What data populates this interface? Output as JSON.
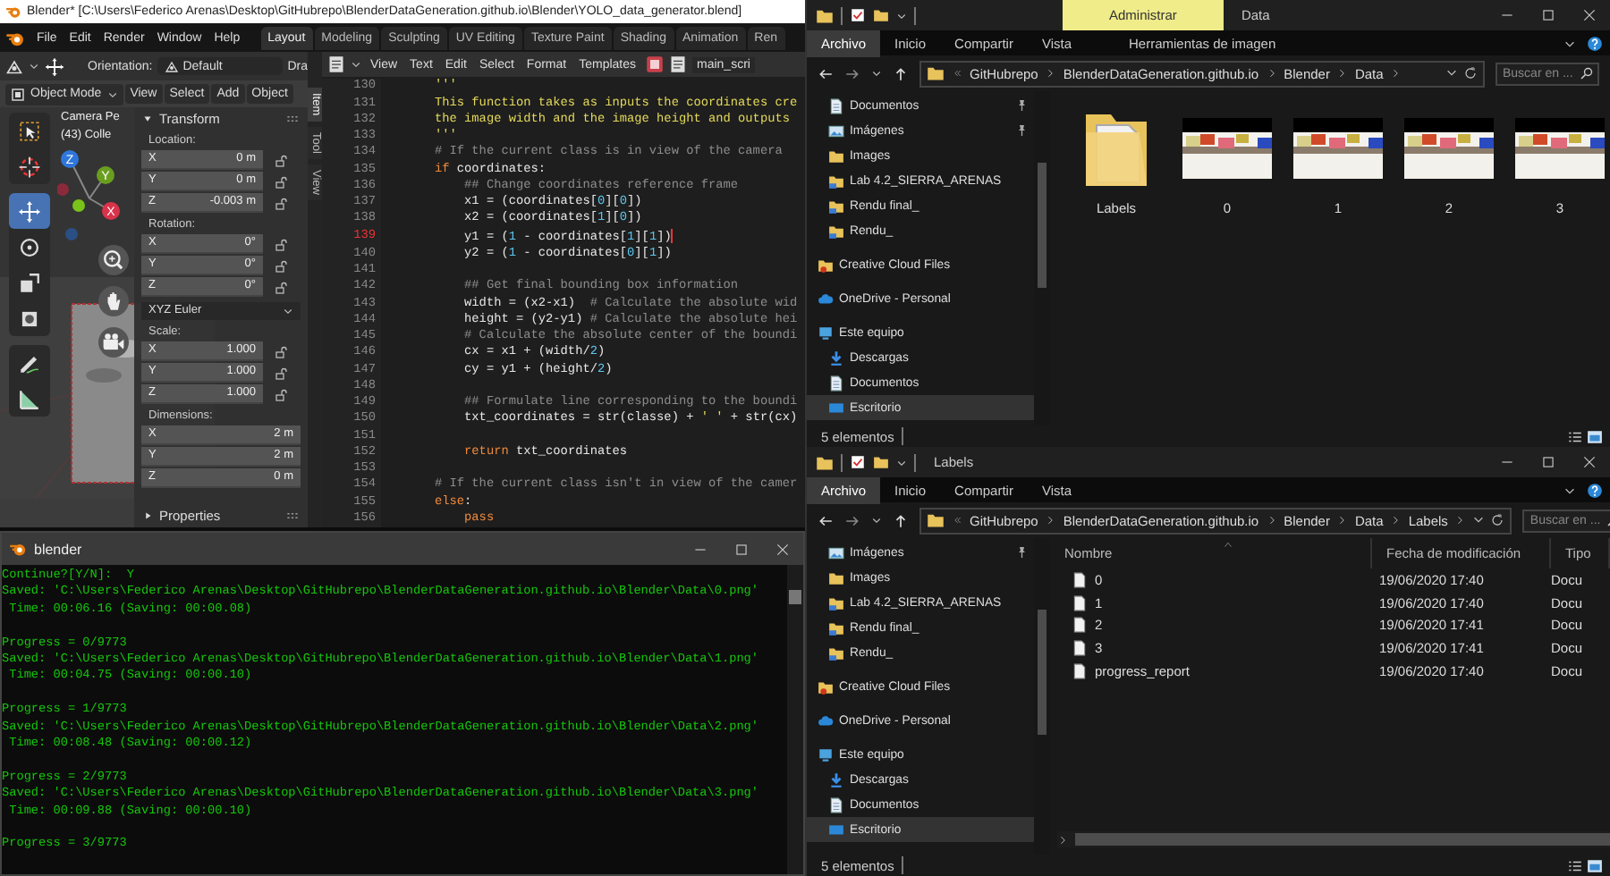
{
  "blender": {
    "title": "Blender* [C:\\Users\\Federico Arenas\\Desktop\\GitHubrepo\\BlenderDataGeneration.github.io\\Blender\\YOLO_data_generator.blend]",
    "menu": [
      "File",
      "Edit",
      "Render",
      "Window",
      "Help"
    ],
    "workspaces": [
      {
        "label": "Layout",
        "selected": true
      },
      {
        "label": "Modeling",
        "selected": false
      },
      {
        "label": "Sculpting",
        "selected": false
      },
      {
        "label": "UV Editing",
        "selected": false
      },
      {
        "label": "Texture Paint",
        "selected": false
      },
      {
        "label": "Shading",
        "selected": false
      },
      {
        "label": "Animation",
        "selected": false
      },
      {
        "label": "Ren",
        "selected": false
      }
    ],
    "viewport": {
      "orientation_label": "Orientation:",
      "orientation": "Default",
      "cut_label": "Dra",
      "mode": "Object Mode",
      "menu": [
        "View",
        "Select",
        "Add",
        "Object"
      ],
      "overlay": [
        "Camera Pe",
        "(43) Colle"
      ],
      "axes": [
        "Z",
        "Y",
        "X"
      ],
      "tool_groups": [
        [
          {
            "kind": "select",
            "selected": false
          },
          {
            "kind": "cursor",
            "selected": false
          }
        ],
        [
          {
            "kind": "move",
            "selected": true
          },
          {
            "kind": "rotate",
            "selected": false
          },
          {
            "kind": "scale",
            "selected": false
          },
          {
            "kind": "transform",
            "selected": false
          }
        ],
        [
          {
            "kind": "annotate",
            "selected": false
          },
          {
            "kind": "measure",
            "selected": false
          }
        ]
      ],
      "sidebar_tabs": [
        {
          "label": "Item",
          "selected": true
        },
        {
          "label": "Tool",
          "selected": false
        },
        {
          "label": "View",
          "selected": false
        }
      ],
      "transform": {
        "title": "Transform",
        "sections": [
          {
            "kind": "fields",
            "label": "Location:",
            "lockable": true,
            "fields": [
              {
                "axis": "X",
                "value": "0 m"
              },
              {
                "axis": "Y",
                "value": "0 m"
              },
              {
                "axis": "Z",
                "value": "-0.003 m"
              }
            ]
          },
          {
            "kind": "fields",
            "label": "Rotation:",
            "lockable": true,
            "fields": [
              {
                "axis": "X",
                "value": "0°"
              },
              {
                "axis": "Y",
                "value": "0°"
              },
              {
                "axis": "Z",
                "value": "0°"
              }
            ]
          },
          {
            "kind": "dropdown",
            "value": "XYZ Euler"
          },
          {
            "kind": "fields",
            "label": "Scale:",
            "lockable": true,
            "fields": [
              {
                "axis": "X",
                "value": "1.000"
              },
              {
                "axis": "Y",
                "value": "1.000"
              },
              {
                "axis": "Z",
                "value": "1.000"
              }
            ]
          },
          {
            "kind": "fields",
            "label": "Dimensions:",
            "lockable": false,
            "fields": [
              {
                "axis": "X",
                "value": "2 m"
              },
              {
                "axis": "Y",
                "value": "2 m"
              },
              {
                "axis": "Z",
                "value": "0 m"
              }
            ]
          }
        ]
      },
      "properties": {
        "label": "Properties",
        "expanded": false
      }
    },
    "text_editor": {
      "menu": [
        "View",
        "Text",
        "Edit",
        "Select",
        "Format",
        "Templates"
      ],
      "file": "main_scri",
      "lines": [
        {
          "number": "130",
          "selected": false,
          "segments": [
            {
              "kind": "string",
              "text": "'''"
            }
          ]
        },
        {
          "number": "131",
          "selected": false,
          "segments": [
            {
              "kind": "string",
              "text": "This function takes as inputs the coordinates cre"
            }
          ]
        },
        {
          "number": "132",
          "selected": false,
          "segments": [
            {
              "kind": "string",
              "text": "the image width and the image height and outputs"
            }
          ]
        },
        {
          "number": "133",
          "selected": false,
          "segments": [
            {
              "kind": "string",
              "text": "'''"
            }
          ]
        },
        {
          "number": "134",
          "selected": false,
          "segments": [
            {
              "kind": "comment",
              "text": "# If the current class is in view of the camera"
            }
          ]
        },
        {
          "number": "135",
          "selected": false,
          "segments": [
            {
              "kind": "keyword",
              "text": "if"
            },
            {
              "kind": "plain",
              "text": " coordinates:"
            }
          ]
        },
        {
          "number": "136",
          "selected": false,
          "segments": [
            {
              "kind": "comment",
              "text": "    ## Change coordinates reference frame"
            }
          ]
        },
        {
          "number": "137",
          "selected": false,
          "segments": [
            {
              "kind": "plain",
              "text": "    x1 = (coordinates["
            },
            {
              "kind": "number",
              "text": "0"
            },
            {
              "kind": "plain",
              "text": "]["
            },
            {
              "kind": "number",
              "text": "0"
            },
            {
              "kind": "plain",
              "text": "])"
            }
          ]
        },
        {
          "number": "138",
          "selected": false,
          "segments": [
            {
              "kind": "plain",
              "text": "    x2 = (coordinates["
            },
            {
              "kind": "number",
              "text": "1"
            },
            {
              "kind": "plain",
              "text": "]["
            },
            {
              "kind": "number",
              "text": "0"
            },
            {
              "kind": "plain",
              "text": "])"
            }
          ]
        },
        {
          "number": "139",
          "selected": true,
          "segments": [
            {
              "kind": "plain",
              "text": "    y1 = ("
            },
            {
              "kind": "number",
              "text": "1"
            },
            {
              "kind": "plain",
              "text": " - coordinates["
            },
            {
              "kind": "number",
              "text": "1"
            },
            {
              "kind": "plain",
              "text": "]["
            },
            {
              "kind": "number",
              "text": "1"
            },
            {
              "kind": "plain",
              "text": "])"
            }
          ]
        },
        {
          "number": "140",
          "selected": false,
          "segments": [
            {
              "kind": "plain",
              "text": "    y2 = ("
            },
            {
              "kind": "number",
              "text": "1"
            },
            {
              "kind": "plain",
              "text": " - coordinates["
            },
            {
              "kind": "number",
              "text": "0"
            },
            {
              "kind": "plain",
              "text": "]["
            },
            {
              "kind": "number",
              "text": "1"
            },
            {
              "kind": "plain",
              "text": "])"
            }
          ]
        },
        {
          "number": "141",
          "selected": false
        },
        {
          "number": "142",
          "selected": false,
          "segments": [
            {
              "kind": "comment",
              "text": "    ## Get final bounding box information"
            }
          ]
        },
        {
          "number": "143",
          "selected": false,
          "segments": [
            {
              "kind": "plain",
              "text": "    width = (x2-x1)  "
            },
            {
              "kind": "comment",
              "text": "# Calculate the absolute wid"
            }
          ]
        },
        {
          "number": "144",
          "selected": false,
          "segments": [
            {
              "kind": "plain",
              "text": "    height = (y2-y1) "
            },
            {
              "kind": "comment",
              "text": "# Calculate the absolute hei"
            }
          ]
        },
        {
          "number": "145",
          "selected": false,
          "segments": [
            {
              "kind": "comment",
              "text": "    # Calculate the absolute center of the boundi"
            }
          ]
        },
        {
          "number": "146",
          "selected": false,
          "segments": [
            {
              "kind": "plain",
              "text": "    cx = x1 + (width/"
            },
            {
              "kind": "number",
              "text": "2"
            },
            {
              "kind": "plain",
              "text": ")"
            }
          ]
        },
        {
          "number": "147",
          "selected": false,
          "segments": [
            {
              "kind": "plain",
              "text": "    cy = y1 + (height/"
            },
            {
              "kind": "number",
              "text": "2"
            },
            {
              "kind": "plain",
              "text": ")"
            }
          ]
        },
        {
          "number": "148",
          "selected": false
        },
        {
          "number": "149",
          "selected": false,
          "segments": [
            {
              "kind": "comment",
              "text": "    ## Formulate line corresponding to the boundi"
            }
          ]
        },
        {
          "number": "150",
          "selected": false,
          "segments": [
            {
              "kind": "plain",
              "text": "    txt_coordinates = str(classe) + "
            },
            {
              "kind": "string",
              "text": "' '"
            },
            {
              "kind": "plain",
              "text": " + str(cx)"
            }
          ]
        },
        {
          "number": "151",
          "selected": false
        },
        {
          "number": "152",
          "selected": false,
          "segments": [
            {
              "kind": "keyword",
              "text": "    return"
            },
            {
              "kind": "plain",
              "text": " txt_coordinates"
            }
          ]
        },
        {
          "number": "153",
          "selected": false
        },
        {
          "number": "154",
          "selected": false,
          "segments": [
            {
              "kind": "comment",
              "text": "# If the current class isn't in view of the camer"
            }
          ]
        },
        {
          "number": "155",
          "selected": false,
          "segments": [
            {
              "kind": "keyword",
              "text": "else"
            },
            {
              "kind": "plain",
              "text": ":"
            }
          ]
        },
        {
          "number": "156",
          "selected": false,
          "segments": [
            {
              "kind": "keyword",
              "text": "    pass"
            }
          ]
        }
      ]
    }
  },
  "console": {
    "title": "blender",
    "blocks": [
      [
        "Continue?[Y/N]:  Y",
        "Saved: 'C:\\Users\\Federico Arenas\\Desktop\\GitHubrepo\\BlenderDataGeneration.github.io\\Blender\\Data\\0.png'",
        " Time: 00:06.16 (Saving: 00:00.08)"
      ],
      [
        "Progress = 0/9773",
        "Saved: 'C:\\Users\\Federico Arenas\\Desktop\\GitHubrepo\\BlenderDataGeneration.github.io\\Blender\\Data\\1.png'",
        " Time: 00:04.75 (Saving: 00:00.10)"
      ],
      [
        "Progress = 1/9773",
        "Saved: 'C:\\Users\\Federico Arenas\\Desktop\\GitHubrepo\\BlenderDataGeneration.github.io\\Blender\\Data\\2.png'",
        " Time: 00:08.48 (Saving: 00:00.12)"
      ],
      [
        "Progress = 2/9773",
        "Saved: 'C:\\Users\\Federico Arenas\\Desktop\\GitHubrepo\\BlenderDataGeneration.github.io\\Blender\\Data\\3.png'",
        " Time: 00:09.88 (Saving: 00:00.10)"
      ],
      [
        "Progress = 3/9773"
      ]
    ]
  },
  "explorers": [
    {
      "title": "Data",
      "context_tab": "Administrar",
      "ribbon": [
        {
          "label": "Archivo",
          "selected": true
        },
        {
          "label": "Inicio",
          "selected": false
        },
        {
          "label": "Compartir",
          "selected": false
        },
        {
          "label": "Vista",
          "selected": false
        },
        {
          "label": "Herramientas de imagen",
          "selected": false
        }
      ],
      "path": [
        "GitHubrepo",
        "BlenderDataGeneration.github.io",
        "Blender",
        "Data"
      ],
      "search": {
        "placeholder": "Buscar en ..."
      },
      "quick_access": [
        {
          "label": "Documentos",
          "kind": "documents",
          "pinned": true,
          "selected": false
        },
        {
          "label": "Imágenes",
          "kind": "pictures",
          "pinned": true,
          "selected": false
        },
        {
          "label": "Images",
          "kind": "folder",
          "pinned": false,
          "selected": false
        },
        {
          "label": "Lab 4.2_SIERRA_ARENAS",
          "kind": "netfolder",
          "pinned": false,
          "selected": false
        },
        {
          "label": "Rendu final_",
          "kind": "netfolder",
          "pinned": false,
          "selected": false
        },
        {
          "label": "Rendu_",
          "kind": "netfolder",
          "pinned": false,
          "selected": false
        }
      ],
      "nav": [
        {
          "label": "Creative Cloud Files",
          "kind": "ccfolder",
          "selected": false
        },
        {
          "label": "OneDrive - Personal",
          "kind": "cloud",
          "selected": false
        },
        {
          "label": "Este equipo",
          "kind": "computer",
          "selected": false,
          "children": [
            {
              "label": "Descargas",
              "kind": "downloads",
              "selected": false
            },
            {
              "label": "Documentos",
              "kind": "documents",
              "selected": false
            },
            {
              "label": "Escritorio",
              "kind": "desktop",
              "selected": true
            }
          ]
        }
      ],
      "content": {
        "kind": "icons",
        "items": [
          {
            "label": "Labels",
            "kind": "folder"
          },
          {
            "label": "0",
            "kind": "image"
          },
          {
            "label": "1",
            "kind": "image"
          },
          {
            "label": "2",
            "kind": "image"
          },
          {
            "label": "3",
            "kind": "image"
          }
        ]
      },
      "status": "5 elementos"
    },
    {
      "title": "Labels",
      "ribbon": [
        {
          "label": "Archivo",
          "selected": true
        },
        {
          "label": "Inicio",
          "selected": false
        },
        {
          "label": "Compartir",
          "selected": false
        },
        {
          "label": "Vista",
          "selected": false
        }
      ],
      "path": [
        "GitHubrepo",
        "BlenderDataGeneration.github.io",
        "Blender",
        "Data",
        "Labels"
      ],
      "search": {
        "placeholder": "Buscar en ..."
      },
      "quick_access": [
        {
          "label": "Imágenes",
          "kind": "pictures",
          "pinned": true,
          "selected": false
        },
        {
          "label": "Images",
          "kind": "folder",
          "pinned": false,
          "selected": false
        },
        {
          "label": "Lab 4.2_SIERRA_ARENAS",
          "kind": "netfolder",
          "pinned": false,
          "selected": false
        },
        {
          "label": "Rendu final_",
          "kind": "netfolder",
          "pinned": false,
          "selected": false
        },
        {
          "label": "Rendu_",
          "kind": "netfolder",
          "pinned": false,
          "selected": false
        }
      ],
      "nav": [
        {
          "label": "Creative Cloud Files",
          "kind": "ccfolder",
          "selected": false
        },
        {
          "label": "OneDrive - Personal",
          "kind": "cloud",
          "selected": false
        },
        {
          "label": "Este equipo",
          "kind": "computer",
          "selected": false,
          "children": [
            {
              "label": "Descargas",
              "kind": "downloads",
              "selected": false
            },
            {
              "label": "Documentos",
              "kind": "documents",
              "selected": false
            },
            {
              "label": "Escritorio",
              "kind": "desktop",
              "selected": true
            }
          ]
        }
      ],
      "content": {
        "kind": "details",
        "columns": [
          "Nombre",
          "Fecha de modificación",
          "Tipo"
        ],
        "rows": [
          {
            "name": "0",
            "modified": "19/06/2020 17:40",
            "type": "Docu"
          },
          {
            "name": "1",
            "modified": "19/06/2020 17:40",
            "type": "Docu"
          },
          {
            "name": "2",
            "modified": "19/06/2020 17:41",
            "type": "Docu"
          },
          {
            "name": "3",
            "modified": "19/06/2020 17:41",
            "type": "Docu"
          },
          {
            "name": "progress_report",
            "modified": "19/06/2020 17:40",
            "type": "Docu"
          }
        ]
      },
      "status": "5 elementos"
    }
  ]
}
